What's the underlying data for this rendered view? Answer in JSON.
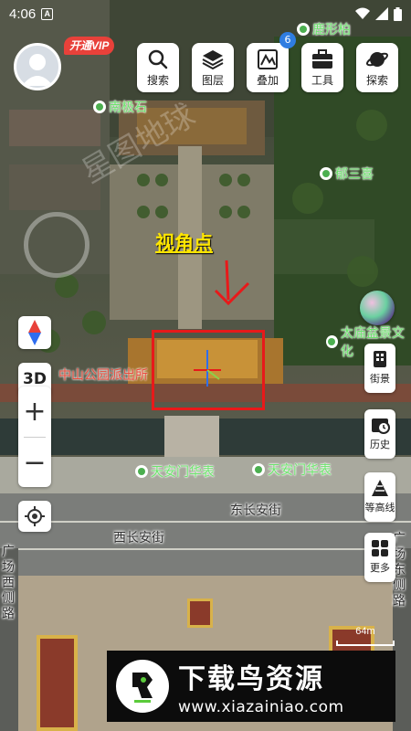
{
  "status_bar": {
    "time": "4:06",
    "a_badge": "A"
  },
  "vip_label": "开通VIP",
  "toolbar": [
    {
      "label": "搜索",
      "icon": "search-icon"
    },
    {
      "label": "图层",
      "icon": "layers-icon"
    },
    {
      "label": "叠加",
      "icon": "overlay-icon",
      "badge": "6"
    },
    {
      "label": "工具",
      "icon": "toolbox-icon"
    },
    {
      "label": "探索",
      "icon": "planet-icon"
    }
  ],
  "right_controls": [
    {
      "label": "街景",
      "icon": "street-view-icon"
    },
    {
      "label": "历史",
      "icon": "history-icon"
    },
    {
      "label": "等高线",
      "icon": "contour-icon"
    },
    {
      "label": "更多",
      "icon": "more-grid-icon"
    }
  ],
  "left_controls": {
    "mode_3d": "3D",
    "zoom_in": "+",
    "zoom_out": "−"
  },
  "map_labels": {
    "poi_top_right": "鹿形柏",
    "poi_nanjishi": "南极石",
    "poi_busanxi": "郁三喜",
    "viewpoint": "视角点",
    "poi_taimiao": "太庙盆景文化",
    "poi_zhongshan": "中山公园派出所",
    "poi_tiananmen_left": "天安门华表",
    "poi_tiananmen_right": "天安门华表",
    "road_dongchangan": "东长安街",
    "road_xichangan": "西长安街",
    "road_guangchang_west": "广场西侧路",
    "road_guangchang_east": "广场东侧路",
    "map_watermark": "星图地球"
  },
  "scale": "64m",
  "banner": {
    "title": "下载鸟资源",
    "url": "www.xiazainiao.com"
  },
  "colors": {
    "vip": "#e8413a",
    "badge": "#2f7de1",
    "annotation_red": "#e8191a",
    "viewpoint_text": "#ffe600"
  }
}
